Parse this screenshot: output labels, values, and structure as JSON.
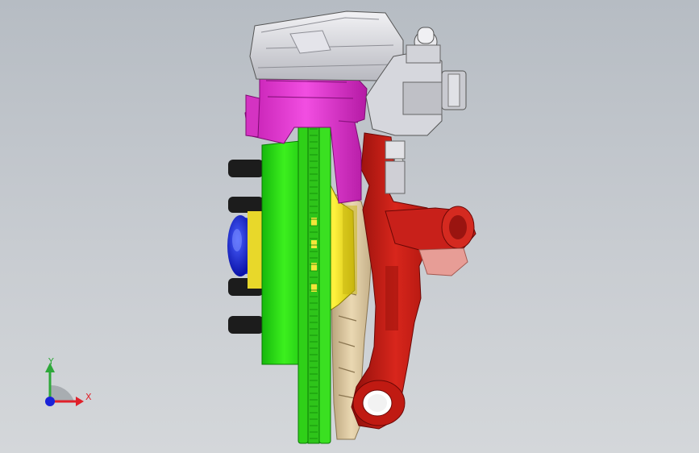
{
  "viewport": {
    "background_top": "#b6bcc3",
    "background_bottom": "#d4d7da"
  },
  "triad": {
    "x_label": "X",
    "y_label": "Y",
    "x_color": "#e0202a",
    "y_color": "#2ea83a",
    "z_color": "#1a22d8"
  },
  "model": {
    "parts": [
      {
        "name": "caliper-body",
        "color": "#dcdde2"
      },
      {
        "name": "caliper-bracket",
        "color": "#e63cd2"
      },
      {
        "name": "brake-rotor-hat",
        "color": "#22dd11"
      },
      {
        "name": "brake-rotor-vented",
        "color": "#33cc22"
      },
      {
        "name": "wheel-hub",
        "color": "#f2e63a"
      },
      {
        "name": "hub-cap",
        "color": "#1a2ad8"
      },
      {
        "name": "steering-knuckle",
        "color": "#cc1a12"
      },
      {
        "name": "dust-shield",
        "color": "#d6c29a"
      },
      {
        "name": "wheel-studs",
        "color": "#1a1a1a"
      }
    ]
  }
}
